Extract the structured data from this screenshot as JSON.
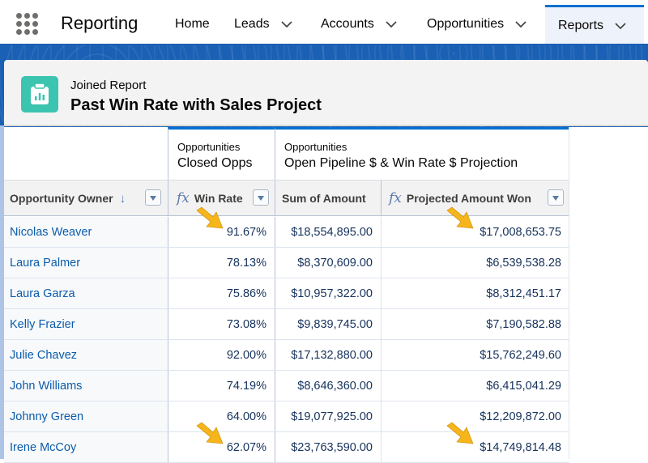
{
  "app": {
    "name": "Reporting",
    "launcher_icon": "app-launcher-grid-icon"
  },
  "nav": {
    "items": [
      {
        "label": "Home",
        "has_dropdown": false,
        "active": false
      },
      {
        "label": "Leads",
        "has_dropdown": true,
        "active": false
      },
      {
        "label": "Accounts",
        "has_dropdown": true,
        "active": false
      },
      {
        "label": "Opportunities",
        "has_dropdown": true,
        "active": false
      },
      {
        "label": "Reports",
        "has_dropdown": true,
        "active": true
      }
    ]
  },
  "header": {
    "icon": "report-clipboard-chart-icon",
    "type_label": "Joined Report",
    "title": "Past Win Rate with Sales Project"
  },
  "blocks": [
    {
      "object": "Opportunities",
      "name": "Closed Opps"
    },
    {
      "object": "Opportunities",
      "name": "Open Pipeline $ & Win Rate $ Projection"
    }
  ],
  "columns": [
    {
      "label": "Opportunity Owner",
      "sorted": "descending",
      "has_menu": true,
      "formula": false
    },
    {
      "label": "Win Rate",
      "has_menu": true,
      "formula": true
    },
    {
      "label": "Sum of Amount",
      "has_menu": false,
      "formula": false
    },
    {
      "label": "Projected Amount Won",
      "has_menu": true,
      "formula": true
    }
  ],
  "formula_glyph": "fx",
  "sort_glyph": "↓",
  "rows": [
    {
      "owner": "Nicolas Weaver",
      "win_rate": "91.67%",
      "sum_amount": "$18,554,895.00",
      "projected": "$17,008,653.75",
      "highlighted": true
    },
    {
      "owner": "Laura Palmer",
      "win_rate": "78.13%",
      "sum_amount": "$8,370,609.00",
      "projected": "$6,539,538.28",
      "highlighted": false
    },
    {
      "owner": "Laura Garza",
      "win_rate": "75.86%",
      "sum_amount": "$10,957,322.00",
      "projected": "$8,312,451.17",
      "highlighted": false
    },
    {
      "owner": "Kelly Frazier",
      "win_rate": "73.08%",
      "sum_amount": "$9,839,745.00",
      "projected": "$7,190,582.88",
      "highlighted": false
    },
    {
      "owner": "Julie Chavez",
      "win_rate": "92.00%",
      "sum_amount": "$17,132,880.00",
      "projected": "$15,762,249.60",
      "highlighted": false
    },
    {
      "owner": "John Williams",
      "win_rate": "74.19%",
      "sum_amount": "$8,646,360.00",
      "projected": "$6,415,041.29",
      "highlighted": false
    },
    {
      "owner": "Johnny Green",
      "win_rate": "64.00%",
      "sum_amount": "$19,077,925.00",
      "projected": "$12,209,872.00",
      "highlighted": false
    },
    {
      "owner": "Irene McCoy",
      "win_rate": "62.07%",
      "sum_amount": "$23,763,590.00",
      "projected": "$14,749,814.48",
      "highlighted": true
    }
  ],
  "colors": {
    "brand_blue": "#0070d2",
    "report_icon_teal": "#3bc4b0",
    "link_blue": "#0b5cab",
    "annotation_arrow": "#f5b51b"
  }
}
